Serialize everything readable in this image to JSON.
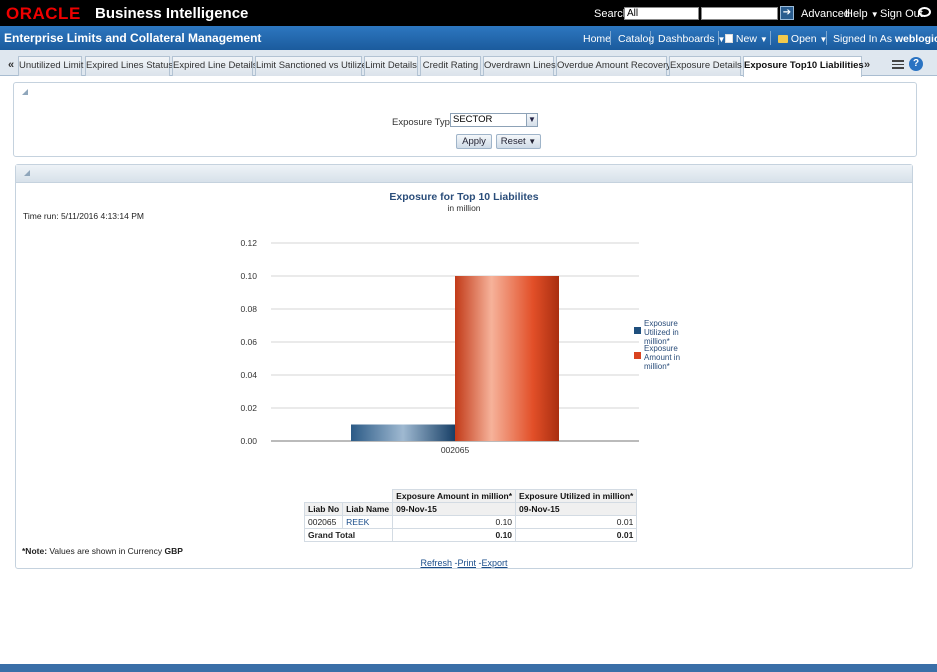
{
  "topbar": {
    "logo": "ORACLE",
    "app_name": "Business Intelligence",
    "search_label": "Search",
    "search_scope": "All",
    "search_value": "",
    "advanced": "Advanced",
    "help": "Help",
    "sign_out": "Sign Out"
  },
  "appbar": {
    "title": "Enterprise Limits and Collateral Management",
    "home": "Home",
    "catalog": "Catalog",
    "dashboards": "Dashboards",
    "new": "New",
    "open": "Open",
    "signed_in_as": "Signed In As",
    "user": "weblogic"
  },
  "tabs": [
    {
      "label": "Unutilized Limit"
    },
    {
      "label": "Expired Lines Status"
    },
    {
      "label": "Expired Line Details"
    },
    {
      "label": "Limit Sanctioned vs Utilized"
    },
    {
      "label": "Limit Details"
    },
    {
      "label": "Credit Rating"
    },
    {
      "label": "Overdrawn Lines"
    },
    {
      "label": "Overdue Amount Recovery"
    },
    {
      "label": "Exposure Details"
    },
    {
      "label": "Exposure Top10 Liabilities"
    }
  ],
  "active_tab": "Exposure Top10 Liabilities",
  "prompts": {
    "exposure_type_label": "Exposure Type",
    "exposure_type_value": "SECTOR",
    "apply": "Apply",
    "reset": "Reset"
  },
  "report": {
    "time_run": "Time run: 5/11/2016 4:13:14 PM",
    "note_prefix": "*Note:",
    "note_text": " Values are shown in Currency ",
    "currency": "GBP",
    "refresh": "Refresh",
    "print": "Print",
    "export": "Export"
  },
  "chart_data": {
    "type": "bar",
    "title": "Exposure for Top 10 Liabilites",
    "subtitle": "in million",
    "categories": [
      "002065"
    ],
    "series": [
      {
        "name": "Exposure Utilized in million*",
        "values": [
          0.01
        ],
        "color": "#1f4f7d"
      },
      {
        "name": "Exposure Amount in million*",
        "values": [
          0.1
        ],
        "color": "#d9431f"
      }
    ],
    "ylim": [
      0,
      0.12
    ],
    "yticks": [
      "0.12",
      "0.10",
      "0.08",
      "0.06",
      "0.04",
      "0.02",
      "0.00"
    ],
    "grid": true,
    "legend": "right"
  },
  "table": {
    "col_exposure_amount": "Exposure Amount in million*",
    "col_exposure_utilized": "Exposure Utilized in million*",
    "col_liab_no": "Liab No",
    "col_liab_name": "Liab Name",
    "date1": "09-Nov-15",
    "date2": "09-Nov-15",
    "rows": [
      {
        "liab_no": "002065",
        "liab_name": "REEK",
        "amount": "0.10",
        "utilized": "0.01"
      }
    ],
    "grand_total_label": "Grand Total",
    "total_amount": "0.10",
    "total_utilized": "0.01"
  }
}
